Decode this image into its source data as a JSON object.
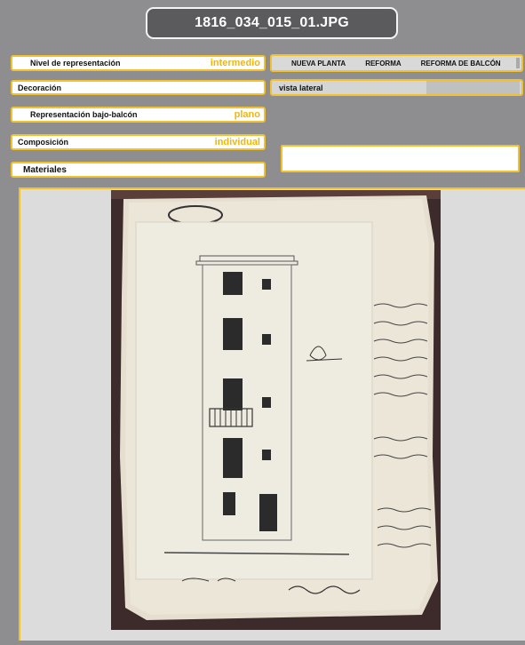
{
  "title": "1816_034_015_01.JPG",
  "fields": {
    "nivel": {
      "label": "Nivel de representación",
      "value": "intermedio"
    },
    "decoracion": {
      "label": "Decoración"
    },
    "bajo_balcon": {
      "label": "Representación bajo-balcón",
      "value": "plano"
    },
    "composicion": {
      "label": "Composición",
      "value": "individual"
    },
    "materiales": {
      "label": "Materiales"
    }
  },
  "tags": [
    "NUEVA PLANTA",
    "REFORMA",
    "REFORMA DE BALCÓN"
  ],
  "vista": "vista lateral",
  "colors": {
    "background": "#8e8e90",
    "accent": "#f2c12e",
    "value_text": "#f2b705",
    "title_bg": "#5b5b5d"
  }
}
